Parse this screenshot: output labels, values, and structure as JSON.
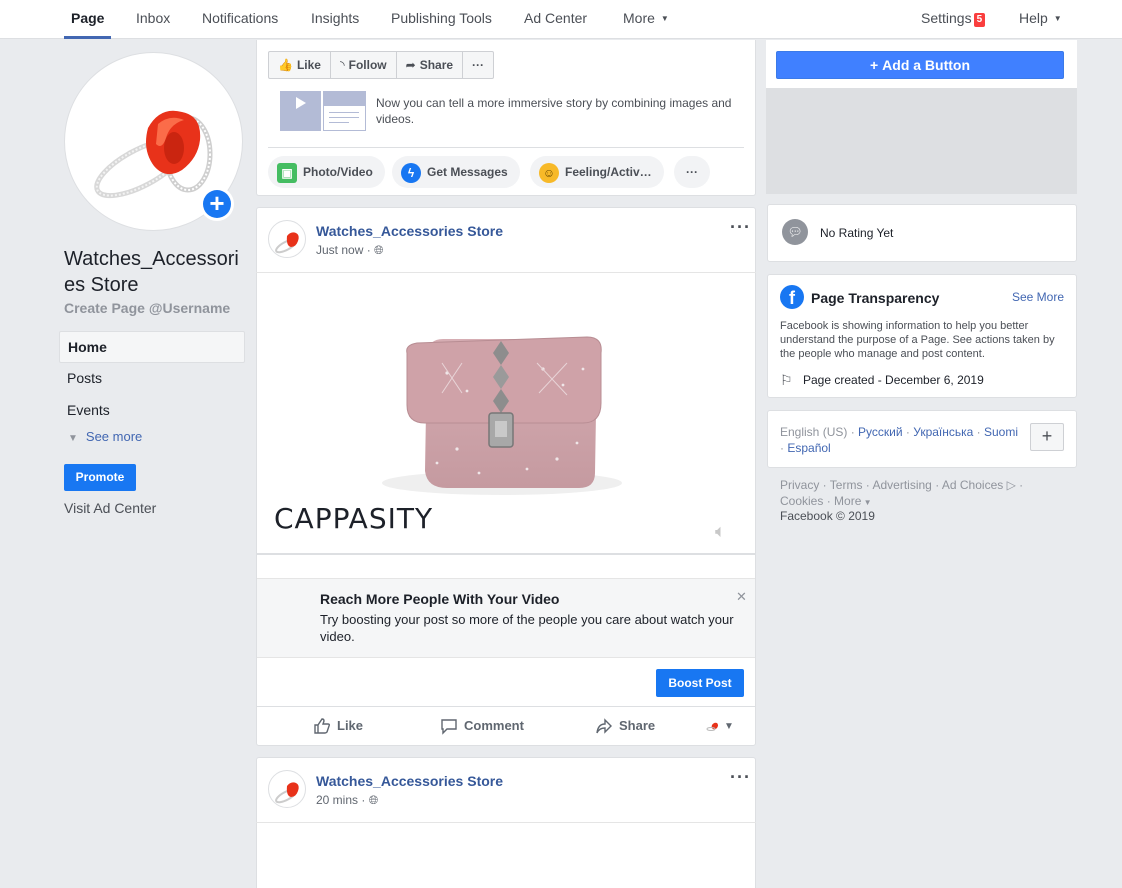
{
  "topnav": {
    "tabs": [
      {
        "label": "Page",
        "active": true
      },
      {
        "label": "Inbox"
      },
      {
        "label": "Notifications"
      },
      {
        "label": "Insights"
      },
      {
        "label": "Publishing Tools"
      },
      {
        "label": "Ad Center"
      },
      {
        "label": "More"
      }
    ],
    "settings_label": "Settings",
    "settings_badge": "5",
    "help_label": "Help"
  },
  "left": {
    "page_name": "Watches_Accessories Store",
    "username_link": "Create Page @Username",
    "nav": [
      {
        "label": "Home",
        "active": true
      },
      {
        "label": "Posts"
      },
      {
        "label": "Events"
      }
    ],
    "see_more": "See more",
    "promote": "Promote",
    "visit_ad_center": "Visit Ad Center"
  },
  "actions": {
    "like": "Like",
    "follow": "Follow",
    "share": "Share",
    "more": "···"
  },
  "composer": {
    "tip": "Now you can tell a more immersive story by combining images and videos.",
    "chips": [
      "Photo/Video",
      "Get Messages",
      "Feeling/Activ…",
      "···"
    ]
  },
  "post1": {
    "author": "Watches_Accessories Store",
    "time": "Just now",
    "brand_watermark": "CAPPASITY",
    "boost_title": "Reach More People With Your Video",
    "boost_text": "Try boosting your post so more of the people you care about watch your video.",
    "boost_button": "Boost Post",
    "like": "Like",
    "comment": "Comment",
    "share": "Share"
  },
  "post2": {
    "author": "Watches_Accessories Store",
    "time": "20 mins"
  },
  "right": {
    "add_button": "Add a Button",
    "rating": "No Rating Yet",
    "transparency_title": "Page Transparency",
    "transparency_see_more": "See More",
    "transparency_desc": "Facebook is showing information to help you better understand the purpose of a Page. See actions taken by the people who manage and post content.",
    "page_created": "Page created - December 6, 2019",
    "current_language": "English (US)",
    "languages": [
      "Русский",
      "Українська",
      "Suomi",
      "Español"
    ],
    "footer_links": [
      "Privacy",
      "Terms",
      "Advertising",
      "Ad Choices",
      "Cookies",
      "More"
    ],
    "copyright": "Facebook © 2019"
  },
  "colors": {
    "primary": "#1877f2",
    "link": "#365899",
    "background": "#e9ebee"
  }
}
